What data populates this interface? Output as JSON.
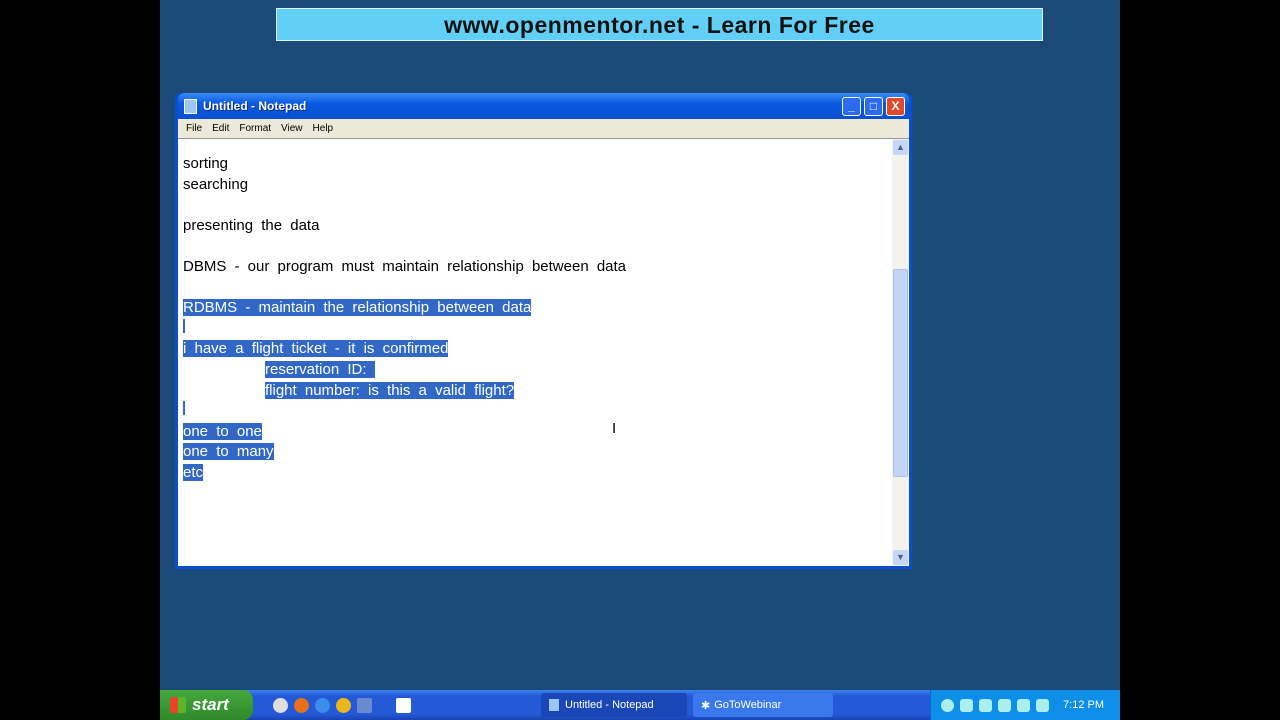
{
  "banner": {
    "text": "www.openmentor.net   -   Learn For Free"
  },
  "window": {
    "title": "Untitled - Notepad",
    "controls": {
      "minimize": "_",
      "maximize": "□",
      "close": "X"
    },
    "menu": [
      "File",
      "Edit",
      "Format",
      "View",
      "Help"
    ]
  },
  "editor": {
    "lines": [
      {
        "text": "sorting",
        "selected": false
      },
      {
        "text": "searching",
        "selected": false
      },
      {
        "text": "",
        "selected": false
      },
      {
        "text": "presenting the data",
        "selected": false
      },
      {
        "text": "",
        "selected": false
      },
      {
        "text": "DBMS - our program must maintain relationship between data",
        "selected": false
      },
      {
        "text": "",
        "selected": false
      },
      {
        "text": "RDBMS - maintain the relationship between data",
        "selected": true
      },
      {
        "text": "",
        "selected": true
      },
      {
        "text": "i have a flight ticket - it is confirmed",
        "selected": true
      },
      {
        "text": "reservation ID: ",
        "selected": true,
        "indent": true
      },
      {
        "text": "flight number: is this a valid flight?",
        "selected": true,
        "indent": true
      },
      {
        "text": "",
        "selected": true
      },
      {
        "text": "one to one",
        "selected": true
      },
      {
        "text": "one to many",
        "selected": true
      },
      {
        "text": "etc",
        "selected": true
      }
    ]
  },
  "taskbar": {
    "start": "start",
    "tasks": [
      "Untitled - Notepad",
      "GoToWebinar"
    ],
    "clock": "7:12 PM"
  }
}
